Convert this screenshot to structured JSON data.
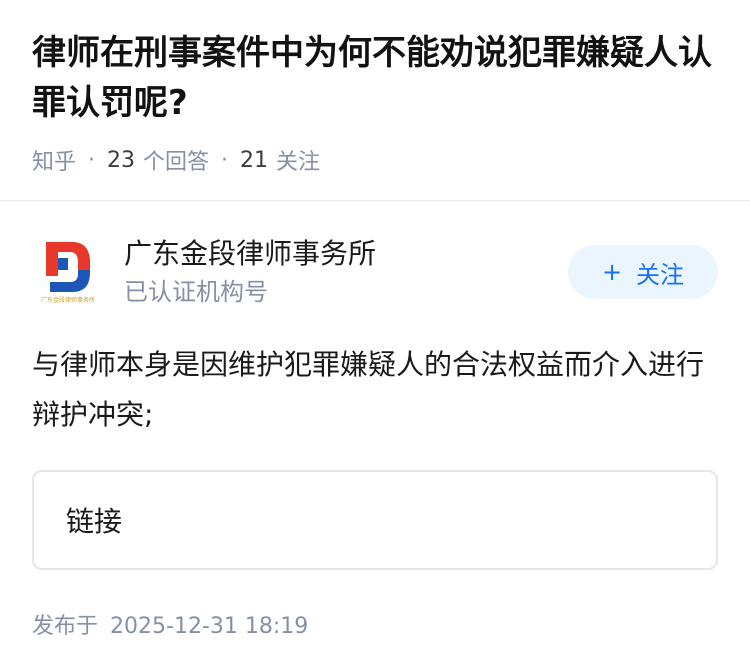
{
  "question": {
    "title": "律师在刑事案件中为何不能劝说犯罪嫌疑人认罪认罚呢?",
    "source": "知乎",
    "answers_count": "23",
    "answers_label": "个回答",
    "follows_count": "21",
    "follows_label": "关注"
  },
  "author": {
    "name": "广东金段律师事务所",
    "tag": "已认证机构号",
    "logo_text": "广东金段律师事务所",
    "logo_colors": {
      "red": "#e8382b",
      "blue": "#1f57b8",
      "gold": "#c9a02a"
    },
    "follow_label": "关注",
    "follow_plus": "+"
  },
  "content": {
    "text": "与律师本身是因维护犯罪嫌疑人的合法权益而介入进行辩护冲突;"
  },
  "link_card": {
    "label": "链接"
  },
  "publish": {
    "label": "发布于",
    "time": "2025-12-31 18:19"
  }
}
